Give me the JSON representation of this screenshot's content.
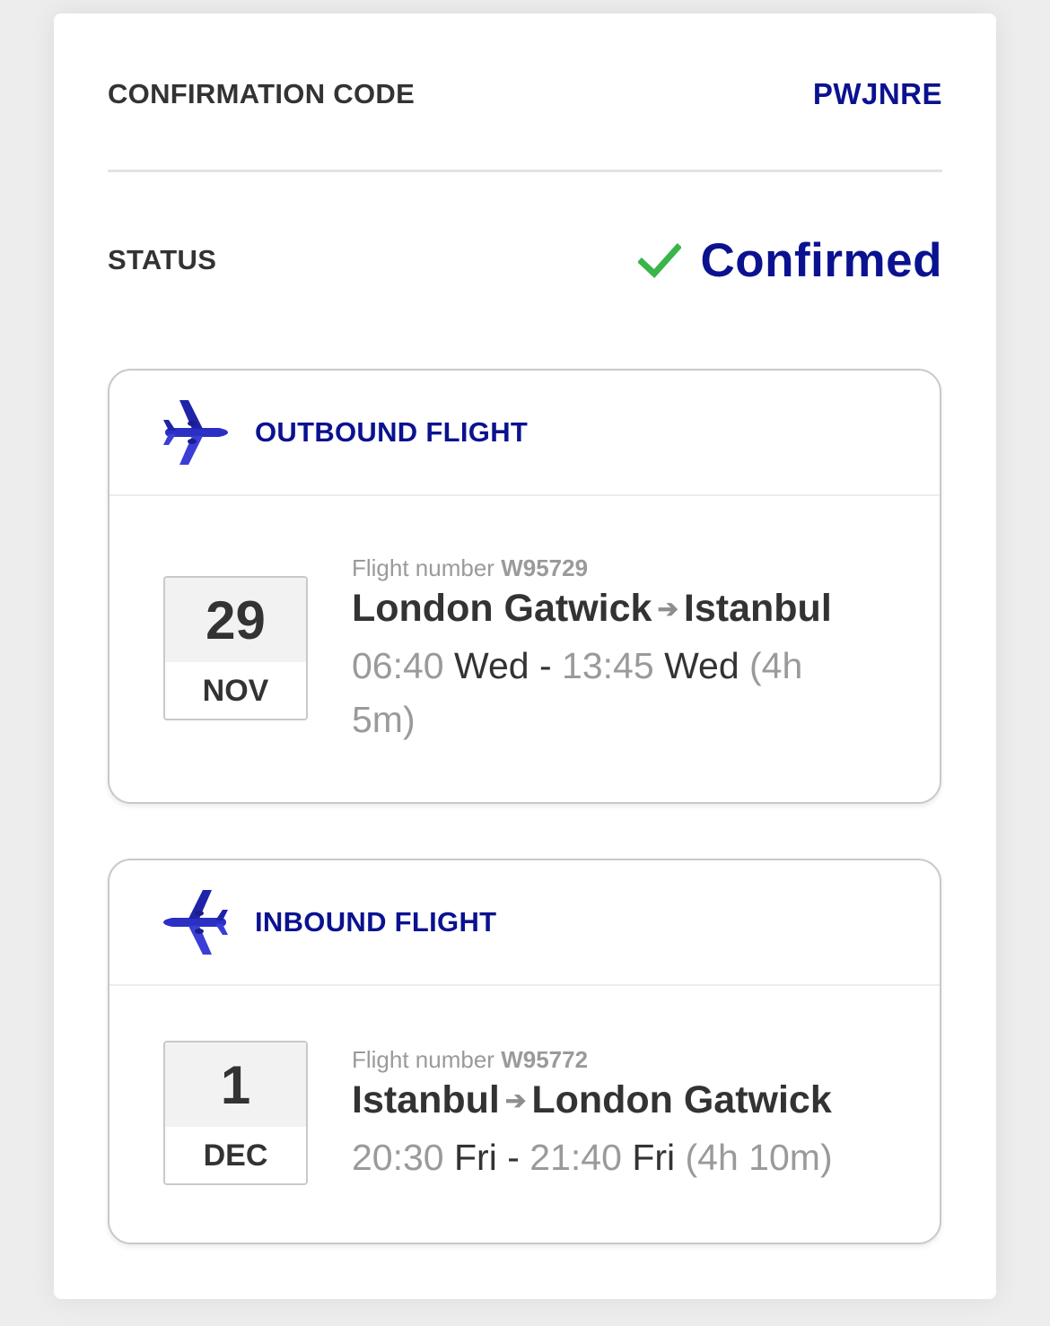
{
  "confirmation": {
    "label": "CONFIRMATION CODE",
    "code": "PWJNRE"
  },
  "status": {
    "label": "STATUS",
    "value": "Confirmed",
    "icon": "check-icon",
    "icon_color": "#3ab54a"
  },
  "colors": {
    "brand": "#0a1290",
    "text": "#333333",
    "muted": "#9a9a9a"
  },
  "outbound": {
    "title": "OUTBOUND FLIGHT",
    "icon": "plane-right-icon",
    "date_day": "29",
    "date_month": "NOV",
    "flight_number_label": "Flight number",
    "flight_number": "W95729",
    "from": "London Gatwick",
    "to": "Istanbul",
    "dep_time": "06:40",
    "dep_day": "Wed",
    "separator": "-",
    "arr_time": "13:45",
    "arr_day": "Wed",
    "duration": "(4h 5m)"
  },
  "inbound": {
    "title": "INBOUND FLIGHT",
    "icon": "plane-left-icon",
    "date_day": "1",
    "date_month": "DEC",
    "flight_number_label": "Flight number",
    "flight_number": "W95772",
    "from": "Istanbul",
    "to": "London Gatwick",
    "dep_time": "20:30",
    "dep_day": "Fri",
    "separator": "-",
    "arr_time": "21:40",
    "arr_day": "Fri",
    "duration": "(4h 10m)"
  }
}
